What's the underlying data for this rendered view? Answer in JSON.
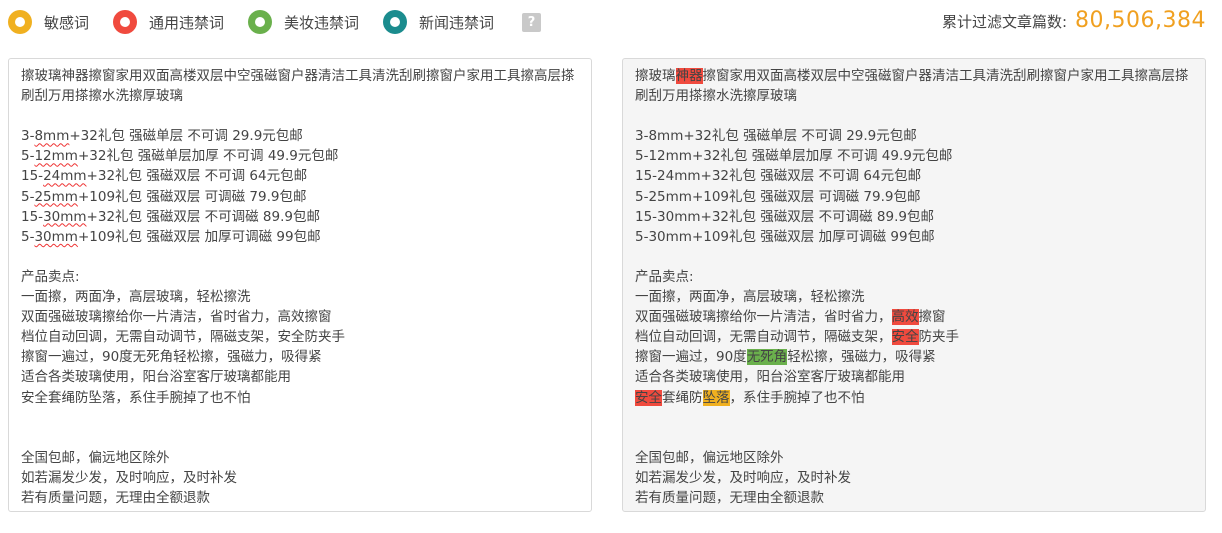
{
  "legend": [
    {
      "label": "敏感词",
      "color": "#f0b020",
      "icon": "sensitive-word-dot"
    },
    {
      "label": "通用违禁词",
      "color": "#f04a3e",
      "icon": "general-banned-dot"
    },
    {
      "label": "美妆违禁词",
      "color": "#6ab04c",
      "icon": "beauty-banned-dot"
    },
    {
      "label": "新闻违禁词",
      "color": "#1b8c8e",
      "icon": "news-banned-dot"
    }
  ],
  "help_icon": "?",
  "counter": {
    "label": "累计过滤文章篇数:",
    "value": "80,506,384"
  },
  "input_lines": [
    "擦玻璃神器擦窗家用双面高楼双层中空强磁窗户器清洁工具清洗刮刷擦窗户家用工具擦高层搽刷刮万用搽擦水洗擦厚玻璃",
    "",
    "3-8mm+32礼包 强磁单层 不可调 29.9元包邮",
    "5-12mm+32礼包 强磁单层加厚 不可调  49.9元包邮",
    "15-24mm+32礼包 强磁双层 不可调 64元包邮",
    "5-25mm+109礼包 强磁双层 可调磁  79.9包邮",
    "15-30mm+32礼包 强磁双层 不可调磁  89.9包邮",
    "5-30mm+109礼包  强磁双层 加厚可调磁 99包邮",
    "",
    "产品卖点:",
    "一面擦，两面净，高层玻璃，轻松擦洗",
    "双面强磁玻璃擦给你一片清洁，省时省力，高效擦窗",
    "档位自动回调，无需自动调节，隔磁支架，安全防夹手",
    "擦窗一遍过，90度无死角轻松擦，强磁力，吸得紧",
    "适合各类玻璃使用，阳台浴室客厅玻璃都能用",
    "安全套绳防坠落，系住手腕掉了也不怕",
    "",
    "",
    "全国包邮，偏远地区除外",
    "如若漏发少发，及时响应，及时补发",
    "若有质量问题，无理由全额退款"
  ],
  "squiggle_words": [
    "8mm",
    "12mm",
    "24mm",
    "25mm",
    "30mm",
    "30mm"
  ],
  "output_lines": [
    [
      {
        "t": "擦玻璃"
      },
      {
        "t": "神器",
        "c": "#f04a3e"
      },
      {
        "t": "擦窗家用双面高楼双层中空强磁窗户器清洁工具清洗刮刷擦窗户家用工具擦高层搽刷刮万用搽擦水洗擦厚玻璃"
      }
    ],
    [],
    [
      {
        "t": "3-8mm+32礼包 强磁单层 不可调 29.9元包邮"
      }
    ],
    [
      {
        "t": "5-12mm+32礼包 强磁单层加厚 不可调  49.9元包邮"
      }
    ],
    [
      {
        "t": "15-24mm+32礼包 强磁双层 不可调 64元包邮"
      }
    ],
    [
      {
        "t": "5-25mm+109礼包 强磁双层 可调磁  79.9包邮"
      }
    ],
    [
      {
        "t": "15-30mm+32礼包 强磁双层 不可调磁  89.9包邮"
      }
    ],
    [
      {
        "t": "5-30mm+109礼包  强磁双层 加厚可调磁 99包邮"
      }
    ],
    [],
    [
      {
        "t": "产品卖点:"
      }
    ],
    [
      {
        "t": "一面擦，两面净，高层玻璃，轻松擦洗"
      }
    ],
    [
      {
        "t": "双面强磁玻璃擦给你一片清洁，省时省力，"
      },
      {
        "t": "高效",
        "c": "#f04a3e"
      },
      {
        "t": "擦窗"
      }
    ],
    [
      {
        "t": "档位自动回调，无需自动调节，隔磁支架，"
      },
      {
        "t": "安全",
        "c": "#f04a3e"
      },
      {
        "t": "防夹手"
      }
    ],
    [
      {
        "t": "擦窗一遍过，90度"
      },
      {
        "t": "无死角",
        "c": "#6ab04c"
      },
      {
        "t": "轻松擦，强磁力，吸得紧"
      }
    ],
    [
      {
        "t": "适合各类玻璃使用，阳台浴室客厅玻璃都能用"
      }
    ],
    [
      {
        "t": "安全",
        "c": "#f04a3e"
      },
      {
        "t": "套绳防"
      },
      {
        "t": "坠落",
        "c": "#f0b020"
      },
      {
        "t": "，系住手腕掉了也不怕"
      }
    ],
    [],
    [],
    [
      {
        "t": "全国包邮，偏远地区除外"
      }
    ],
    [
      {
        "t": "如若漏发少发，及时响应，及时补发"
      }
    ],
    [
      {
        "t": "若有质量问题，无理由全额退款"
      }
    ]
  ]
}
